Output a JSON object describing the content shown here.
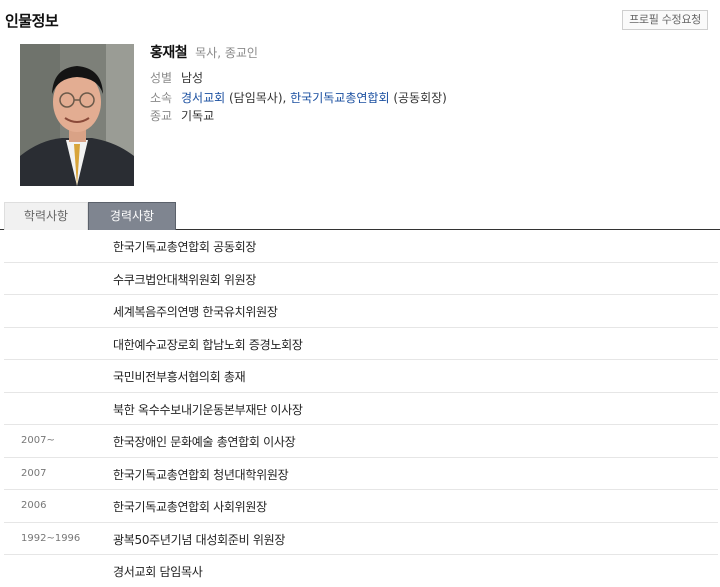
{
  "header": {
    "title": "인물정보",
    "edit_label": "프로필 수정요청"
  },
  "profile": {
    "name": "홍재철",
    "role": "목사, 종교인",
    "gender_label": "성별",
    "gender": "남성",
    "affiliation_label": "소속",
    "affiliation_1": "경서교회",
    "affiliation_1_role": " (담임목사), ",
    "affiliation_2": "한국기독교총연합회",
    "affiliation_2_role": " (공동회장)",
    "religion_label": "종교",
    "religion": "기독교"
  },
  "tabs": [
    {
      "label": "학력사항"
    },
    {
      "label": "경력사항"
    }
  ],
  "career": [
    {
      "year": "",
      "text": "한국기독교총연합회 공동회장"
    },
    {
      "year": "",
      "text": "수쿠크법안대책위원회 위원장"
    },
    {
      "year": "",
      "text": "세계복음주의연맹 한국유치위원장"
    },
    {
      "year": "",
      "text": "대한예수교장로회 합남노회 증경노회장"
    },
    {
      "year": "",
      "text": "국민비전부흥서협의회 총재"
    },
    {
      "year": "",
      "text": "북한 옥수수보내기운동본부재단 이사장"
    },
    {
      "year": "2007~",
      "text": "한국장애인 문화예술 총연합회 이사장"
    },
    {
      "year": "2007",
      "text": "한국기독교총연합회 청년대학위원장"
    },
    {
      "year": "2006",
      "text": "한국기독교총연합회 사회위원장"
    },
    {
      "year": "1992~1996",
      "text": "광복50주년기념 대성회준비 위원장"
    },
    {
      "year": "",
      "text": "경서교회 담임목사"
    }
  ]
}
